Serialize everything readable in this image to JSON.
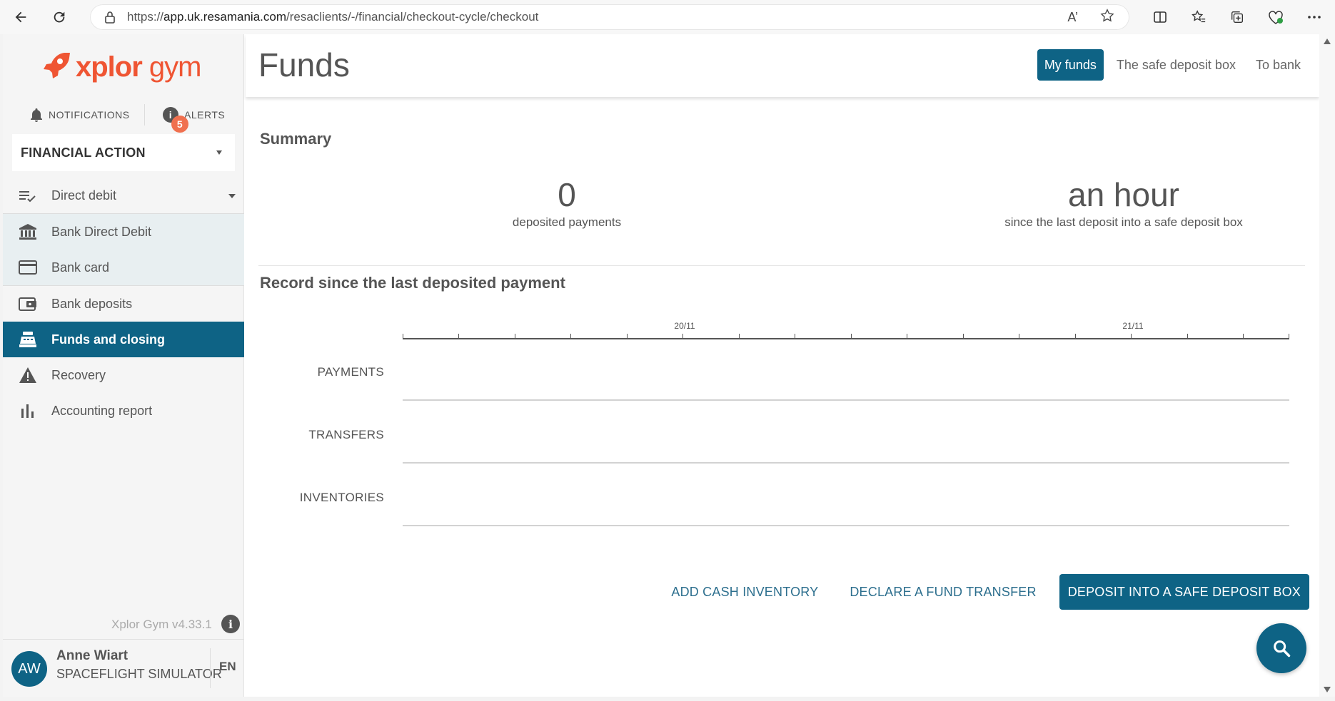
{
  "browser": {
    "url_prefix": "https://",
    "url_host": "app.uk.resamania.com",
    "url_path": "/resaclients/-/financial/checkout-cycle/checkout",
    "read_aloud_label": "A’"
  },
  "sidebar": {
    "logo": {
      "brand": "xplor",
      "product": "gym"
    },
    "notifications_label": "NOTIFICATIONS",
    "alerts_label": "ALERTS",
    "alerts_count": "5",
    "dropdown_label": "FINANCIAL ACTION",
    "menu": {
      "direct_debit": "Direct debit",
      "bank_direct_debit": "Bank Direct Debit",
      "bank_card": "Bank card",
      "bank_deposits": "Bank deposits",
      "funds_and_closing": "Funds and closing",
      "recovery": "Recovery",
      "accounting_report": "Accounting report"
    },
    "version": "Xplor Gym v4.33.1",
    "user": {
      "initials": "AW",
      "name": "Anne Wiart",
      "org": "SPACEFLIGHT SIMULATOR",
      "lang": "EN"
    }
  },
  "header": {
    "title": "Funds",
    "tabs": {
      "my_funds": "My funds",
      "safe_deposit_box": "The safe deposit box",
      "to_bank": "To bank"
    }
  },
  "summary": {
    "title": "Summary",
    "deposited_value": "0",
    "deposited_label": "deposited payments",
    "since_value": "an hour",
    "since_label": "since the last deposit into a safe deposit box"
  },
  "record": {
    "title": "Record since the last deposited payment",
    "tick_labels": {
      "first": "20/11",
      "second": "21/11"
    },
    "rows": {
      "payments": "PAYMENTS",
      "transfers": "TRANSFERS",
      "inventories": "INVENTORIES"
    }
  },
  "actions": {
    "add_cash_inventory": "ADD CASH INVENTORY",
    "declare_fund_transfer": "DECLARE A FUND TRANSFER",
    "deposit_safe_box": "DEPOSIT INTO A SAFE DEPOSIT BOX"
  },
  "colors": {
    "brand_orange": "#ef5533",
    "primary_teal": "#0e6385",
    "badge_orange": "#f0704f"
  }
}
